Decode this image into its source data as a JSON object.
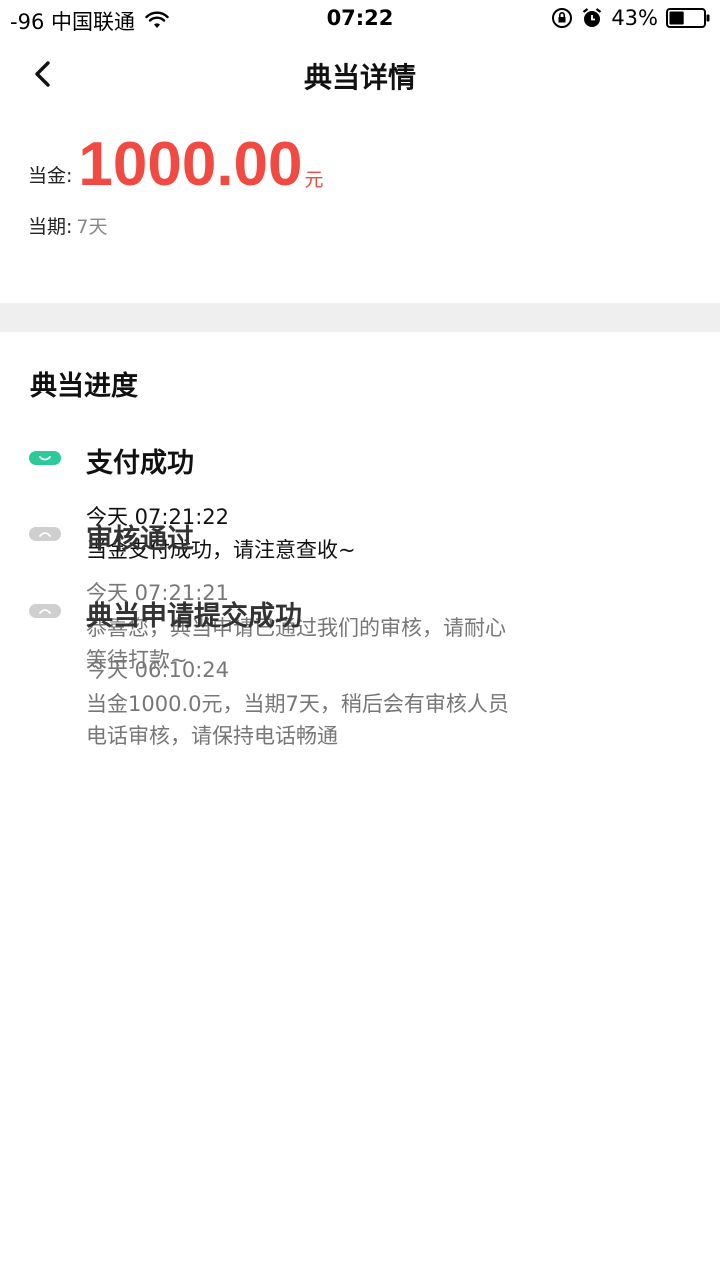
{
  "status_bar": {
    "carrier": "-96 中国联通",
    "time": "07:22",
    "battery": "43%",
    "battery_level": 0.43,
    "icons": [
      "wifi-icon",
      "orientation-lock-icon",
      "alarm-icon",
      "battery-icon"
    ]
  },
  "nav": {
    "title": "典当详情",
    "back_icon": "chevron-left-icon"
  },
  "loan": {
    "amount_label": "当金:",
    "amount": "1000.00",
    "amount_unit": "元",
    "term_label": "当期:",
    "term_value": "7天"
  },
  "progress": {
    "title": "典当进度",
    "steps": [
      {
        "title": "支付成功",
        "time": "今天 07:21:22",
        "desc": "当金支付成功，请注意查收~",
        "status": "done"
      },
      {
        "title": "审核通过",
        "time": "今天 07:21:21",
        "desc": "恭喜您，典当申请已通过我们的审核，请耐心等待打款~",
        "status": "pending"
      },
      {
        "title": "典当申请提交成功",
        "time": "今天 06:10:24",
        "desc": "当金1000.0元，当期7天，稍后会有审核人员电话审核，请保持电话畅通",
        "status": "pending"
      }
    ]
  },
  "colors": {
    "accent_red": "#f04a43",
    "success_green": "#2dc99a",
    "pending_gray": "#cfcfcf",
    "band_gray": "#efefef"
  }
}
